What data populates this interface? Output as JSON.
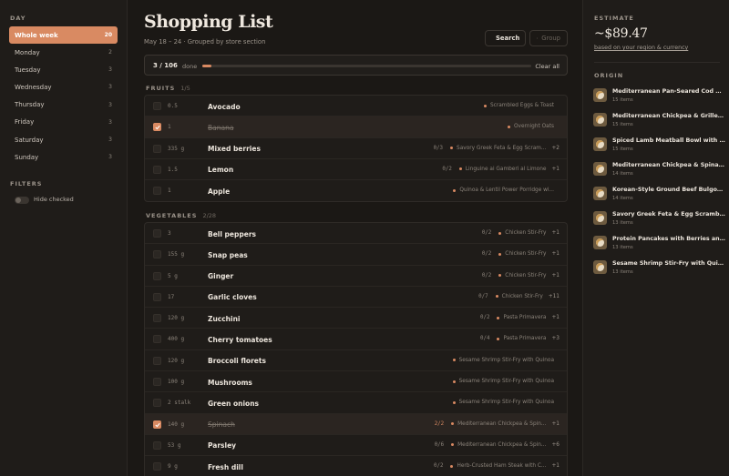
{
  "sidebar": {
    "day_title": "DAY",
    "days": [
      {
        "label": "Whole week",
        "count": "20"
      },
      {
        "label": "Monday",
        "count": "2"
      },
      {
        "label": "Tuesday",
        "count": "3"
      },
      {
        "label": "Wednesday",
        "count": "3"
      },
      {
        "label": "Thursday",
        "count": "3"
      },
      {
        "label": "Friday",
        "count": "3"
      },
      {
        "label": "Saturday",
        "count": "3"
      },
      {
        "label": "Sunday",
        "count": "3"
      }
    ],
    "filters_title": "FILTERS",
    "hide_checked_label": "Hide checked"
  },
  "header": {
    "title": "Shopping List",
    "subtitle": "May 18 – 24 · Grouped by store section",
    "search_label": "Search",
    "group_label": "Group"
  },
  "progress": {
    "count": "3 / 106",
    "done_label": "done",
    "fraction": 0.028,
    "clear_label": "Clear all"
  },
  "sections": [
    {
      "name": "FRUITS",
      "frac": "1/5",
      "items": [
        {
          "qty": "0.5",
          "name": "Avocado",
          "used": "",
          "recipe": "Scrambled Eggs & Toast",
          "more": "",
          "checked": false
        },
        {
          "qty": "1",
          "name": "Banana",
          "used": "",
          "recipe": "Overnight Oats",
          "more": "",
          "checked": true
        },
        {
          "qty": "335 g",
          "name": "Mixed berries",
          "used": "0/3",
          "recipe": "Savory Greek Feta & Egg Scram...",
          "more": "+2",
          "checked": false
        },
        {
          "qty": "1.5",
          "name": "Lemon",
          "used": "0/2",
          "recipe": "Linguine ai Gamberi al Limone",
          "more": "+1",
          "checked": false
        },
        {
          "qty": "1",
          "name": "Apple",
          "used": "",
          "recipe": "Quinoa & Lentil Power Porridge wi...",
          "more": "",
          "checked": false
        }
      ]
    },
    {
      "name": "VEGETABLES",
      "frac": "2/28",
      "items": [
        {
          "qty": "3",
          "name": "Bell peppers",
          "used": "0/2",
          "recipe": "Chicken Stir-Fry",
          "more": "+1",
          "checked": false
        },
        {
          "qty": "155 g",
          "name": "Snap peas",
          "used": "0/2",
          "recipe": "Chicken Stir-Fry",
          "more": "+1",
          "checked": false
        },
        {
          "qty": "5 g",
          "name": "Ginger",
          "used": "0/2",
          "recipe": "Chicken Stir-Fry",
          "more": "+1",
          "checked": false
        },
        {
          "qty": "17",
          "name": "Garlic cloves",
          "used": "0/7",
          "recipe": "Chicken Stir-Fry",
          "more": "+11",
          "checked": false
        },
        {
          "qty": "120 g",
          "name": "Zucchini",
          "used": "0/2",
          "recipe": "Pasta Primavera",
          "more": "+1",
          "checked": false
        },
        {
          "qty": "400 g",
          "name": "Cherry tomatoes",
          "used": "0/4",
          "recipe": "Pasta Primavera",
          "more": "+3",
          "checked": false
        },
        {
          "qty": "120 g",
          "name": "Broccoli florets",
          "used": "",
          "recipe": "Sesame Shrimp Stir-Fry with Quinoa",
          "more": "",
          "checked": false
        },
        {
          "qty": "100 g",
          "name": "Mushrooms",
          "used": "",
          "recipe": "Sesame Shrimp Stir-Fry with Quinoa",
          "more": "",
          "checked": false
        },
        {
          "qty": "2 stalk",
          "name": "Green onions",
          "used": "",
          "recipe": "Sesame Shrimp Stir-Fry with Quinoa",
          "more": "",
          "checked": false
        },
        {
          "qty": "140 g",
          "name": "Spinach",
          "used": "2/2",
          "recipe": "Mediterranean Chickpea & Spin...",
          "more": "+1",
          "checked": true
        },
        {
          "qty": "53 g",
          "name": "Parsley",
          "used": "0/6",
          "recipe": "Mediterranean Chickpea & Spin...",
          "more": "+6",
          "checked": false
        },
        {
          "qty": "9 g",
          "name": "Fresh dill",
          "used": "0/2",
          "recipe": "Herb-Crusted Ham Steak with C...",
          "more": "+1",
          "checked": false
        }
      ]
    }
  ],
  "estimate": {
    "title": "ESTIMATE",
    "value": "~$89.47",
    "note": "based on your region & currency"
  },
  "origin": {
    "title": "ORIGIN",
    "items": [
      {
        "name": "Mediterranean Pan-Seared Cod with...",
        "items": "15 items"
      },
      {
        "name": "Mediterranean Chickpea & Grilled C...",
        "items": "15 items"
      },
      {
        "name": "Spiced Lamb Meatball Bowl with Bul...",
        "items": "15 items"
      },
      {
        "name": "Mediterranean Chickpea & Spinach ...",
        "items": "14 items"
      },
      {
        "name": "Korean-Style Ground Beef Bulgogi B...",
        "items": "14 items"
      },
      {
        "name": "Savory Greek Feta & Egg Scramble ...",
        "items": "13 items"
      },
      {
        "name": "Protein Pancakes with Berries and G...",
        "items": "13 items"
      },
      {
        "name": "Sesame Shrimp Stir-Fry with Quinoa",
        "items": "13 items"
      }
    ]
  },
  "colors": {
    "accent": "#d98a62",
    "background": "#1b1815"
  }
}
